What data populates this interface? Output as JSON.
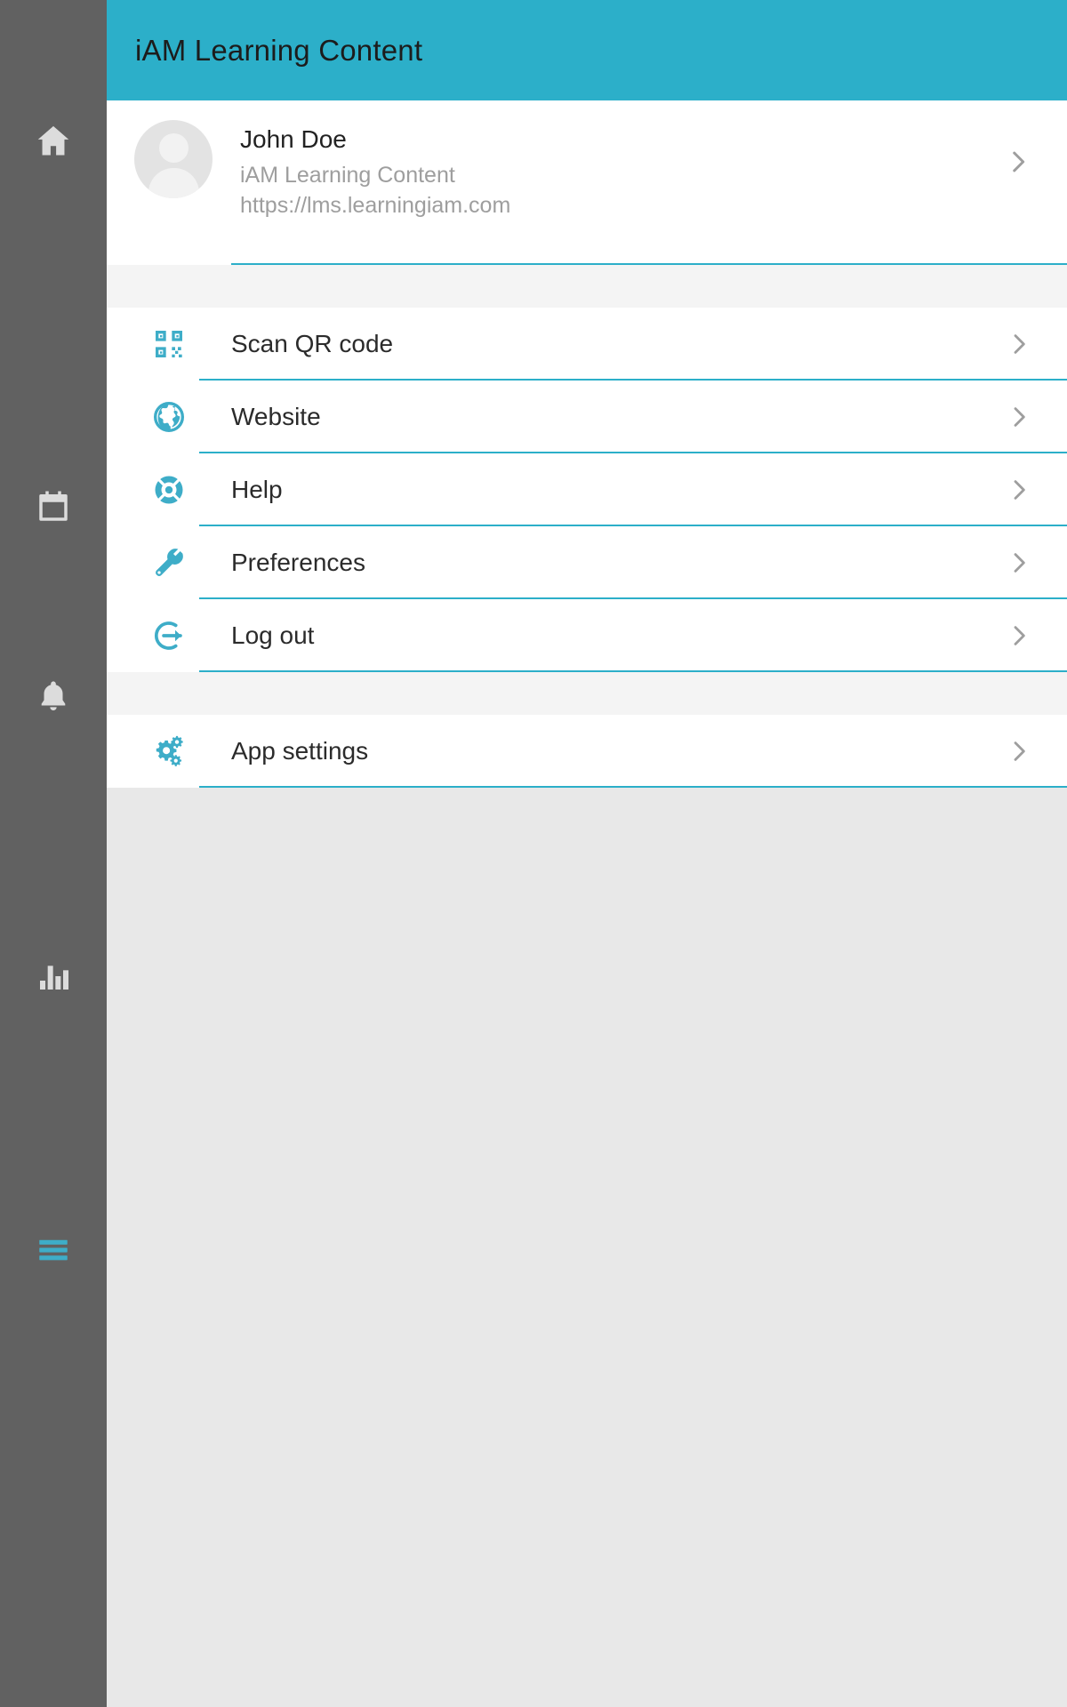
{
  "app": {
    "title": "iAM Learning Content",
    "accent_color": "#2cafc9",
    "rail_color": "#616161",
    "background_color": "#e8e8e8"
  },
  "rail": {
    "items": [
      {
        "name": "home",
        "icon": "home-icon",
        "active": false
      },
      {
        "name": "calendar",
        "icon": "calendar-icon",
        "active": false
      },
      {
        "name": "notifications",
        "icon": "bell-icon",
        "active": false
      },
      {
        "name": "reports",
        "icon": "bar-chart-icon",
        "active": false
      },
      {
        "name": "menu",
        "icon": "hamburger-menu-icon",
        "active": true
      }
    ]
  },
  "account": {
    "name": "John Doe",
    "site": "iAM Learning Content",
    "url": "https://lms.learningiam.com",
    "chevron": "chevron-right-icon"
  },
  "menu": {
    "primary_items": [
      {
        "label": "Scan QR code",
        "icon": "qr-code-icon"
      },
      {
        "label": "Website",
        "icon": "globe-icon"
      },
      {
        "label": "Help",
        "icon": "lifebuoy-icon"
      },
      {
        "label": "Preferences",
        "icon": "wrench-icon"
      },
      {
        "label": "Log out",
        "icon": "logout-icon"
      }
    ],
    "secondary_items": [
      {
        "label": "App settings",
        "icon": "gears-icon"
      }
    ]
  }
}
